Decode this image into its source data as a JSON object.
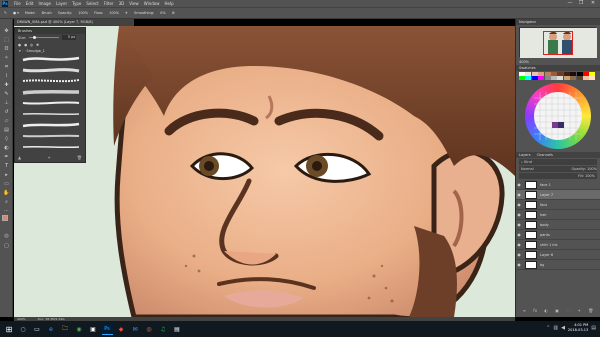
{
  "menubar": {
    "logo": "Ps",
    "items": [
      "File",
      "Edit",
      "Image",
      "Layer",
      "Type",
      "Select",
      "Filter",
      "3D",
      "View",
      "Window",
      "Help"
    ],
    "controls": [
      "—",
      "❐",
      "✕"
    ]
  },
  "optionsbar": {
    "mode_label": "Mode:",
    "mode_value": "Brush",
    "opacity_label": "Opacity:",
    "opacity_value": "100%",
    "flow_label": "Flow:",
    "flow_value": "100%",
    "smoothing_label": "Smoothing:",
    "smoothing_value": "0%"
  },
  "document_tab": "DRAWN_SMA.psd @ 400% (Layer 7, RGB/8)",
  "brushes_panel": {
    "title": "Brushes",
    "size_label": "Size:",
    "size_value": "5 px",
    "folder_name": "Smudge_1",
    "footer_icons": [
      "▲",
      "+",
      "🗑"
    ]
  },
  "navigator": {
    "tab": "Navigator",
    "zoom": "400%"
  },
  "swatches": {
    "tab": "Swatches",
    "colors": [
      "#ffffff",
      "#f5e2d6",
      "#e8c3ad",
      "#d9a07f",
      "#c47d5a",
      "#9c5a3c",
      "#6e3c25",
      "#3f2113",
      "#1d0f08",
      "#000000",
      "#ff0000",
      "#ffff00",
      "#00ff00",
      "#00ffff",
      "#0000ff",
      "#ff00ff",
      "#888888",
      "#bbbbbb",
      "#dddddd",
      "#c9a26f",
      "#8b6b4a",
      "#5d4432",
      "#f0c8a0",
      "#ffe0c0"
    ]
  },
  "layers_panel": {
    "tabs": [
      "Layers",
      "Channels"
    ],
    "kind_label": "Kind",
    "blend_mode": "Normal",
    "opacity": "Opacity: 100%",
    "fill": "Fill: 100%",
    "layers": [
      {
        "name": "face 1",
        "active": false
      },
      {
        "name": "Layer 7",
        "active": true
      },
      {
        "name": "face",
        "active": false
      },
      {
        "name": "hair",
        "active": false
      },
      {
        "name": "body",
        "active": false
      },
      {
        "name": "pants",
        "active": false
      },
      {
        "name": "shirt 1 ink",
        "active": false
      },
      {
        "name": "Layer 6",
        "active": false
      },
      {
        "name": "bg",
        "active": false
      }
    ],
    "footer_icons": [
      "∞",
      "fx",
      "◐",
      "▣",
      "🗀",
      "+",
      "🗑"
    ]
  },
  "statusbar": {
    "zoom": "400%",
    "doc": "Doc: 38.3M/1.54G"
  },
  "taskbar": {
    "start": "⊞",
    "apps": [
      "○",
      "▭",
      "e",
      "🗀",
      "◉",
      "▣",
      "Ps",
      "◆",
      "✉",
      "◎",
      "♫",
      "▤"
    ],
    "time": "4:01 PM",
    "date": "2018-03-13"
  }
}
